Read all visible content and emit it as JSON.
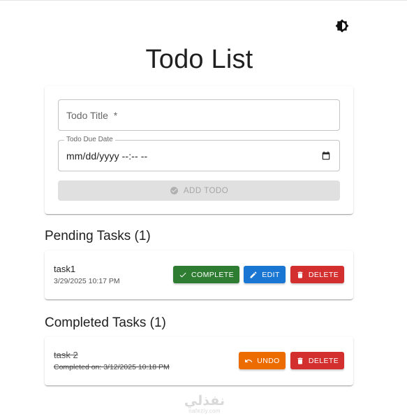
{
  "header": {
    "title": "Todo List",
    "theme_toggle_icon": "brightness-icon"
  },
  "form": {
    "title_placeholder": "Todo Title  *",
    "due_date_label": "Todo Due Date",
    "due_date_value": "mm/dd/yyyy  --:-- --",
    "calendar_icon": "calendar-icon",
    "add_button_label": "ADD TODO",
    "add_button_icon": "check-circle-icon",
    "add_button_disabled": true
  },
  "pending": {
    "heading": "Pending Tasks (1)",
    "tasks": [
      {
        "title": "task1",
        "date": "3/29/2025 10:17 PM",
        "complete_label": "COMPLETE",
        "edit_label": "EDIT",
        "delete_label": "DELETE"
      }
    ]
  },
  "completed": {
    "heading": "Completed Tasks (1)",
    "tasks": [
      {
        "title": "task 2",
        "completed_on": "Completed on: 3/12/2025 10:18 PM",
        "undo_label": "UNDO",
        "delete_label": "DELETE"
      }
    ]
  },
  "watermark": {
    "logo_text": "نفذلي",
    "url": "nafezly.com"
  },
  "colors": {
    "complete": "#2e7d32",
    "edit": "#1976d2",
    "delete": "#d32f2f",
    "undo": "#ed6c02",
    "disabled_bg": "#e0e0e0"
  }
}
